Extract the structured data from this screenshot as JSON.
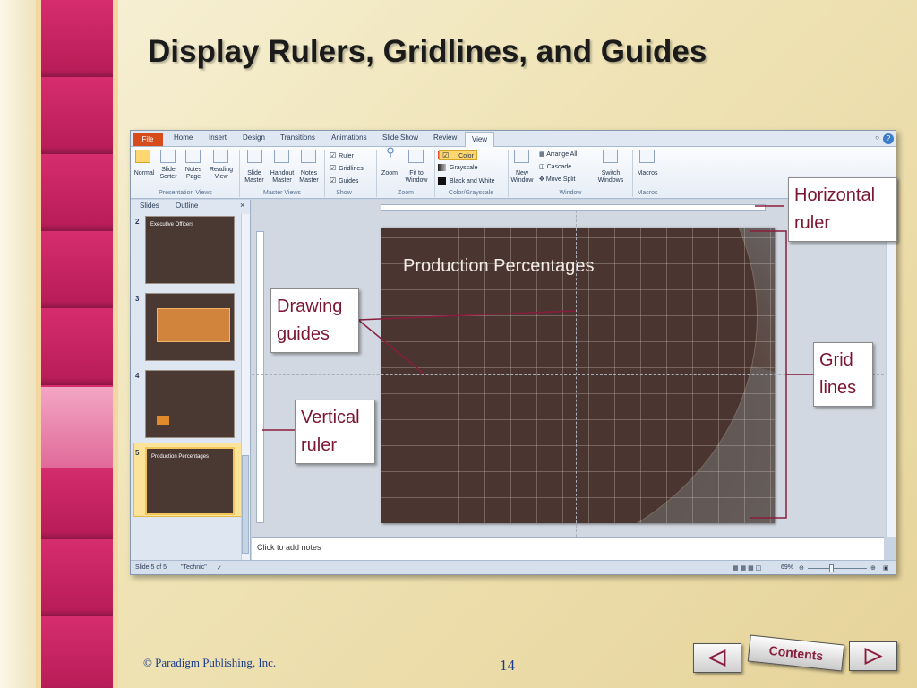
{
  "title": "Display Rulers, Gridlines, and Guides",
  "window": {
    "tabs": [
      "File",
      "Home",
      "Insert",
      "Design",
      "Transitions",
      "Animations",
      "Slide Show",
      "Review",
      "View"
    ],
    "ribbon": {
      "normal": "Normal",
      "slide_sorter": "Slide Sorter",
      "notes_page": "Notes Page",
      "reading_view": "Reading View",
      "presentation_views": "Presentation Views",
      "slide_master": "Slide Master",
      "handout_master": "Handout Master",
      "notes_master": "Notes Master",
      "master_views": "Master Views",
      "ruler": "Ruler",
      "gridlines": "Gridlines",
      "guides": "Guides",
      "show": "Show",
      "zoom": "Zoom",
      "fit_to_window": "Fit to Window",
      "zoom_group": "Zoom",
      "color": "Color",
      "grayscale": "Grayscale",
      "black_and_white": "Black and White",
      "color_grayscale": "Color/Grayscale",
      "new_window": "New Window",
      "arrange_all": "Arrange All",
      "cascade": "Cascade",
      "move_split": "Move Split",
      "switch_windows": "Switch Windows",
      "window": "Window",
      "macros": "Macros",
      "macros_group": "Macros"
    },
    "pane": {
      "slides_tab": "Slides",
      "outline_tab": "Outline",
      "close": "×",
      "thumbs": [
        {
          "num": "2",
          "title": "Executive Officers"
        },
        {
          "num": "3",
          "title": ""
        },
        {
          "num": "4",
          "title": ""
        },
        {
          "num": "5",
          "title": "Production Percentages"
        }
      ]
    },
    "slide_title": "Production Percentages",
    "notes_placeholder": "Click to add notes",
    "status": {
      "slide_info": "Slide 5 of 5",
      "theme": "\"Technic\"",
      "zoom": "69%"
    }
  },
  "callouts": {
    "horizontal_ruler": [
      "Horizontal",
      "ruler"
    ],
    "drawing_guides": [
      "Drawing",
      "guides"
    ],
    "grid_lines": [
      "Grid",
      "lines"
    ],
    "vertical_ruler": [
      "Vertical",
      "ruler"
    ]
  },
  "footer": {
    "copyright": "© Paradigm Publishing, Inc.",
    "page_number": "14",
    "contents": "Contents"
  },
  "colors": {
    "accent_band": "#d62d6e",
    "title_text": "#1b1b1b",
    "callout_text": "#7a1632",
    "callout_line": "#8a1d3e",
    "footer_text": "#1a3a8a"
  }
}
